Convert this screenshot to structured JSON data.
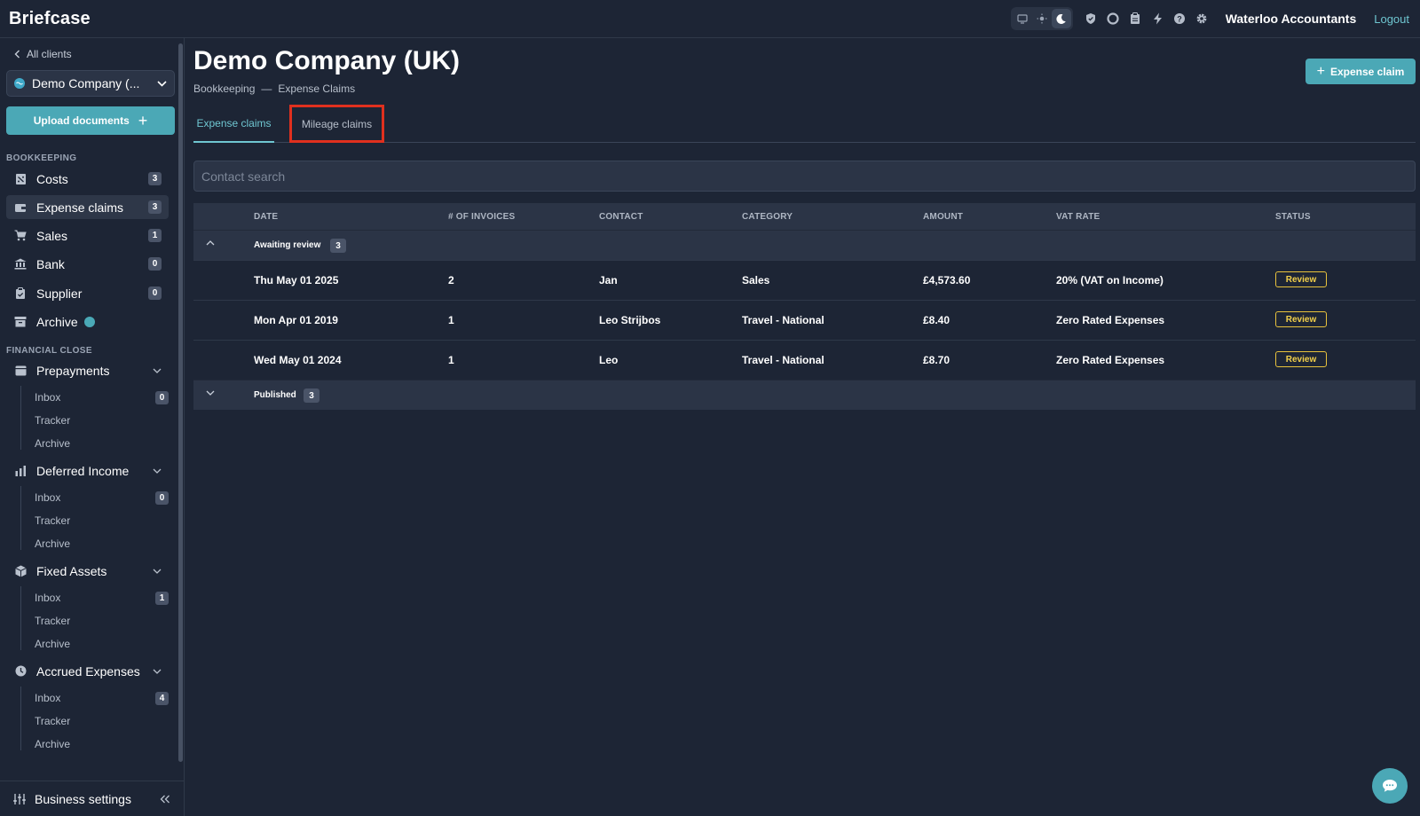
{
  "app": {
    "logo": "Briefcase",
    "org_name": "Waterloo Accountants",
    "logout_label": "Logout",
    "theme_icons": [
      "desktop-icon",
      "sun-icon",
      "moon-icon"
    ],
    "top_icons": [
      "shield-icon",
      "circle-icon",
      "clipboard-icon",
      "bolt-icon",
      "help-icon",
      "gear-icon"
    ]
  },
  "sidebar": {
    "back_label": "All clients",
    "client_name": "Demo Company (...",
    "upload_label": "Upload documents",
    "bookkeeping_label": "BOOKKEEPING",
    "bookkeeping_items": [
      {
        "label": "Costs",
        "count": "3"
      },
      {
        "label": "Expense claims",
        "count": "3"
      },
      {
        "label": "Sales",
        "count": "1"
      },
      {
        "label": "Bank",
        "count": "0"
      },
      {
        "label": "Supplier",
        "count": "0"
      },
      {
        "label": "Archive"
      }
    ],
    "financial_close_label": "FINANCIAL CLOSE",
    "groups": [
      {
        "label": "Prepayments",
        "inbox": "Inbox",
        "inbox_count": "0",
        "tracker": "Tracker",
        "archive": "Archive"
      },
      {
        "label": "Deferred Income",
        "inbox": "Inbox",
        "inbox_count": "0",
        "tracker": "Tracker",
        "archive": "Archive"
      },
      {
        "label": "Fixed Assets",
        "inbox": "Inbox",
        "inbox_count": "1",
        "tracker": "Tracker",
        "archive": "Archive"
      },
      {
        "label": "Accrued Expenses",
        "inbox": "Inbox",
        "inbox_count": "4",
        "tracker": "Tracker",
        "archive": "Archive"
      }
    ],
    "settings_label": "Business settings"
  },
  "main": {
    "title": "Demo Company (UK)",
    "breadcrumb": [
      "Bookkeeping",
      "—",
      "Expense Claims"
    ],
    "new_claim_label": "Expense claim",
    "tabs": [
      {
        "label": "Expense claims",
        "active": true
      },
      {
        "label": "Mileage claims",
        "active": false
      }
    ],
    "search_placeholder": "Contact search",
    "columns": [
      "DATE",
      "# OF INVOICES",
      "CONTACT",
      "CATEGORY",
      "AMOUNT",
      "VAT RATE",
      "STATUS"
    ],
    "groups": [
      {
        "label": "Awaiting review",
        "count": "3",
        "expanded": true
      },
      {
        "label": "Published",
        "count": "3",
        "expanded": false
      }
    ],
    "rows": [
      {
        "date": "Thu May 01 2025",
        "invoices": "2",
        "contact": "Jan",
        "category": "Sales",
        "amount": "£4,573.60",
        "vat": "20% (VAT on Income)",
        "status": "Review"
      },
      {
        "date": "Mon Apr 01 2019",
        "invoices": "1",
        "contact": "Leo Strijbos",
        "category": "Travel - National",
        "amount": "£8.40",
        "vat": "Zero Rated Expenses",
        "status": "Review"
      },
      {
        "date": "Wed May 01 2024",
        "invoices": "1",
        "contact": "Leo",
        "category": "Travel - National",
        "amount": "£8.70",
        "vat": "Zero Rated Expenses",
        "status": "Review"
      }
    ]
  },
  "colors": {
    "background": "#1d2535",
    "accent": "#4ba8b6",
    "review_badge": "#e8c23c",
    "highlight_box": "#e0301e"
  }
}
